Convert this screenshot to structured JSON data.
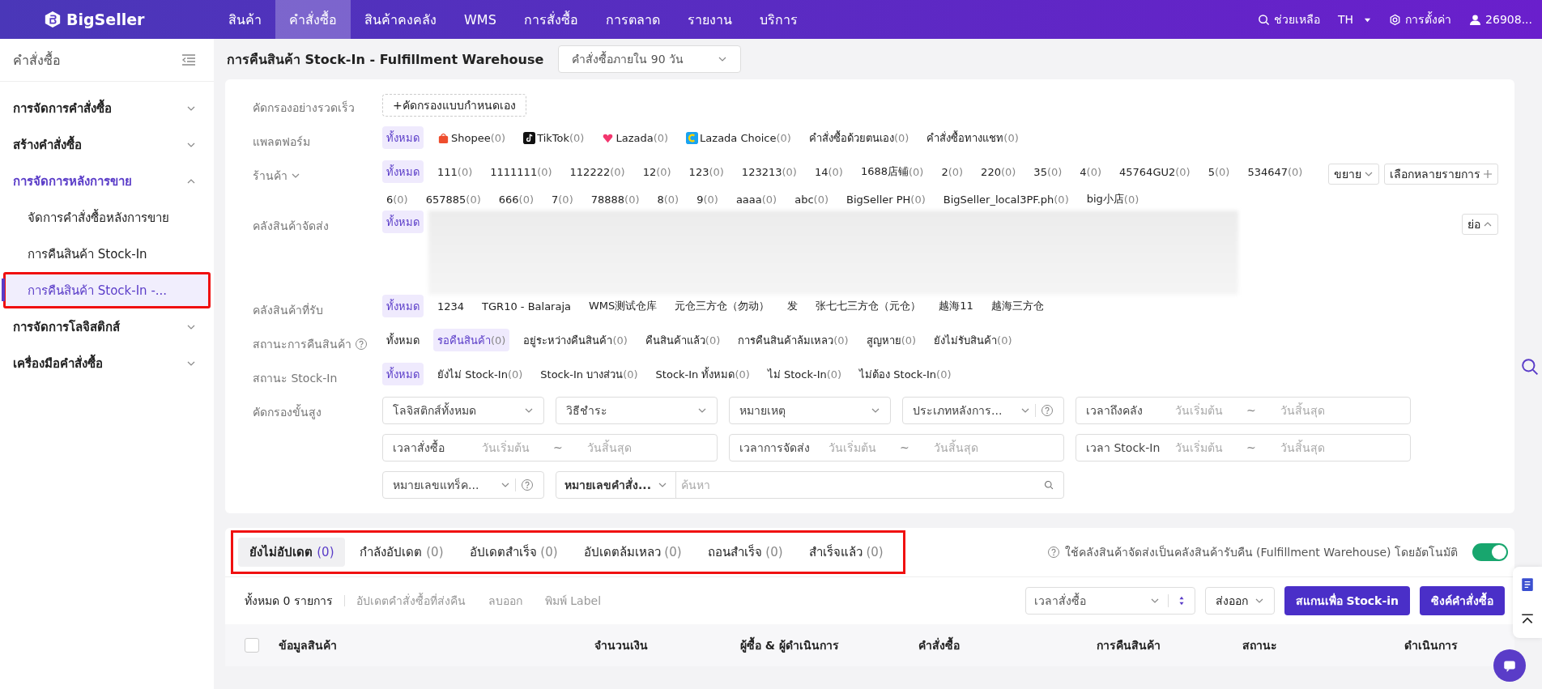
{
  "top_nav": {
    "logo": "BigSeller",
    "items": [
      {
        "label": "สินค้า",
        "selected": false
      },
      {
        "label": "คำสั่งซื้อ",
        "selected": true
      },
      {
        "label": "สินค้าคงคลัง",
        "selected": false
      },
      {
        "label": "WMS",
        "selected": false
      },
      {
        "label": "การสั่งซื้อ",
        "selected": false
      },
      {
        "label": "การตลาด",
        "selected": false
      },
      {
        "label": "รายงาน",
        "selected": false
      },
      {
        "label": "บริการ",
        "selected": false
      }
    ],
    "help": "ช่วยเหลือ",
    "language": "TH",
    "settings": "การตั้งค่า",
    "user": "26908..."
  },
  "sidebar": {
    "title": "คำสั่งซื้อ",
    "groups": [
      {
        "label": "การจัดการคำสั่งซื้อ",
        "expanded": false
      },
      {
        "label": "สร้างคำสั่งซื้อ",
        "expanded": false
      },
      {
        "label": "การจัดการหลังการขาย",
        "expanded": true,
        "children": [
          {
            "label": "จัดการคำสั่งซื้อหลังการขาย",
            "selected": false,
            "highlighted": false
          },
          {
            "label": "การคืนสินค้า Stock-In",
            "selected": false,
            "highlighted": false
          },
          {
            "label": "การคืนสินค้า Stock-In -...",
            "selected": true,
            "highlighted": true
          }
        ]
      },
      {
        "label": "การจัดการโลจิสติกส์",
        "expanded": false
      },
      {
        "label": "เครื่องมือคำสั่งซื้อ",
        "expanded": false
      }
    ]
  },
  "page": {
    "title": "การคืนสินค้า Stock-In - Fulfillment Warehouse",
    "period": "คำสั่งซื้อภายใน 90 วัน"
  },
  "filters": {
    "quick": {
      "label": "คัดกรองอย่างรวดเร็ว",
      "button": "+คัดกรองแบบกำหนดเอง"
    },
    "platform": {
      "label": "แพลตฟอร์ม",
      "options": [
        {
          "label": "ทั้งหมด",
          "selected": true,
          "kind": "all"
        },
        {
          "label": "Shopee",
          "count": "(0)",
          "selected": false,
          "kind": "shopee"
        },
        {
          "label": "TikTok",
          "count": "(0)",
          "selected": false,
          "kind": "tiktok"
        },
        {
          "label": "Lazada",
          "count": "(0)",
          "selected": false,
          "kind": "lazada"
        },
        {
          "label": "Lazada Choice",
          "count": "(0)",
          "selected": false,
          "kind": "lazada_choice"
        },
        {
          "label": "คำสั่งซื้อด้วยตนเอง",
          "count": "(0)",
          "selected": false,
          "kind": "plain"
        },
        {
          "label": "คำสั่งซื้อทางแชท",
          "count": "(0)",
          "selected": false,
          "kind": "plain"
        }
      ]
    },
    "shop": {
      "label": "ร้านค้า",
      "expand": "ขยาย",
      "multi": "เลือกหลายรายการ",
      "options": [
        {
          "label": "ทั้งหมด",
          "selected": true
        },
        {
          "label": "111",
          "count": "(0)",
          "selected": false
        },
        {
          "label": "1111111",
          "count": "(0)",
          "selected": false
        },
        {
          "label": "112222",
          "count": "(0)",
          "selected": false
        },
        {
          "label": "12",
          "count": "(0)",
          "selected": false
        },
        {
          "label": "123",
          "count": "(0)",
          "selected": false
        },
        {
          "label": "123213",
          "count": "(0)",
          "selected": false
        },
        {
          "label": "14",
          "count": "(0)",
          "selected": false
        },
        {
          "label": "1688店铺",
          "count": "(0)",
          "selected": false
        },
        {
          "label": "2",
          "count": "(0)",
          "selected": false
        },
        {
          "label": "220",
          "count": "(0)",
          "selected": false
        },
        {
          "label": "35",
          "count": "(0)",
          "selected": false
        },
        {
          "label": "4",
          "count": "(0)",
          "selected": false
        },
        {
          "label": "45764GU2",
          "count": "(0)",
          "selected": false
        },
        {
          "label": "5",
          "count": "(0)",
          "selected": false
        },
        {
          "label": "534647",
          "count": "(0)",
          "selected": false
        },
        {
          "label": "6",
          "count": "(0)",
          "selected": false
        },
        {
          "label": "657885",
          "count": "(0)",
          "selected": false
        },
        {
          "label": "666",
          "count": "(0)",
          "selected": false
        },
        {
          "label": "7",
          "count": "(0)",
          "selected": false
        },
        {
          "label": "78888",
          "count": "(0)",
          "selected": false
        },
        {
          "label": "8",
          "count": "(0)",
          "selected": false
        },
        {
          "label": "9",
          "count": "(0)",
          "selected": false
        },
        {
          "label": "aaaa",
          "count": "(0)",
          "selected": false
        },
        {
          "label": "abc",
          "count": "(0)",
          "selected": false
        },
        {
          "label": "BigSeller PH",
          "count": "(0)",
          "selected": false
        },
        {
          "label": "BigSeller_local3PF.ph",
          "count": "(0)",
          "selected": false
        },
        {
          "label": "big小店",
          "count": "(0)",
          "selected": false
        }
      ]
    },
    "shipping_warehouse": {
      "label": "คลังสินค้าจัดส่ง",
      "collapse": "ย่อ",
      "options": [
        {
          "label": "ทั้งหมด",
          "selected": true
        }
      ]
    },
    "receiving_warehouse": {
      "label": "คลังสินค้าที่รับ",
      "options": [
        {
          "label": "ทั้งหมด",
          "selected": true
        },
        {
          "label": "1234",
          "selected": false
        },
        {
          "label": "TGR10 - Balaraja",
          "selected": false
        },
        {
          "label": "WMS测试仓库",
          "selected": false
        },
        {
          "label": "元仓三方仓（勿动）",
          "selected": false
        },
        {
          "label": "发",
          "selected": false
        },
        {
          "label": "张七七三方仓（元仓）",
          "selected": false
        },
        {
          "label": "越海11",
          "selected": false
        },
        {
          "label": "越海三方仓",
          "selected": false
        }
      ]
    },
    "return_status": {
      "label": "สถานะการคืนสินค้า",
      "options": [
        {
          "label": "ทั้งหมด",
          "selected": false
        },
        {
          "label": "รอคืนสินค้า",
          "count": "(0)",
          "selected": true
        },
        {
          "label": "อยู่ระหว่างคืนสินค้า",
          "count": "(0)",
          "selected": false
        },
        {
          "label": "คืนสินค้าแล้ว",
          "count": "(0)",
          "selected": false
        },
        {
          "label": "การคืนสินค้าล้มเหลว",
          "count": "(0)",
          "selected": false
        },
        {
          "label": "สูญหาย",
          "count": "(0)",
          "selected": false
        },
        {
          "label": "ยังไม่รับสินค้า",
          "count": "(0)",
          "selected": false
        }
      ]
    },
    "stockin_status": {
      "label": "สถานะ Stock-In",
      "options": [
        {
          "label": "ทั้งหมด",
          "selected": true
        },
        {
          "label": "ยังไม่ Stock-In",
          "count": "(0)",
          "selected": false
        },
        {
          "label": "Stock-In บางส่วน",
          "count": "(0)",
          "selected": false
        },
        {
          "label": "Stock-In ทั้งหมด",
          "count": "(0)",
          "selected": false
        },
        {
          "label": "ไม่ Stock-In",
          "count": "(0)",
          "selected": false
        },
        {
          "label": "ไม่ต้อง Stock-In",
          "count": "(0)",
          "selected": false
        }
      ]
    },
    "advanced": {
      "label": "คัดกรองขั้นสูง",
      "fields": [
        {
          "kind": "select",
          "value": "โลจิสติกส์ทั้งหมด"
        },
        {
          "kind": "select",
          "value": "วิธีชำระ"
        },
        {
          "kind": "select",
          "value": "หมายเหตุ"
        },
        {
          "kind": "select_help",
          "value": "ประเภทหลังการ..."
        },
        {
          "kind": "date_range",
          "label": "เวลาถึงคลัง",
          "start": "วันเริ่มต้น",
          "separator": "~",
          "end": "วันสิ้นสุด"
        },
        {
          "kind": "date_range",
          "label": "เวลาสั่งซื้อ",
          "start": "วันเริ่มต้น",
          "separator": "~",
          "end": "วันสิ้นสุด"
        },
        {
          "kind": "date_range",
          "label": "เวลาการจัดส่ง",
          "start": "วันเริ่มต้น",
          "separator": "~",
          "end": "วันสิ้นสุด"
        },
        {
          "kind": "date_range",
          "label": "เวลา Stock-In",
          "start": "วันเริ่มต้น",
          "separator": "~",
          "end": "วันสิ้นสุด"
        },
        {
          "kind": "select_help",
          "value": "หมายเลขแทร็ค..."
        },
        {
          "kind": "combo_search",
          "value": "หมายเลขคำสั่ง...",
          "placeholder": "ค้นหา"
        }
      ]
    }
  },
  "update_tabs": {
    "highlighted": true,
    "items": [
      {
        "label": "ยังไม่อัปเดต",
        "count": "(0)",
        "selected": true
      },
      {
        "label": "กำลังอัปเดต",
        "count": "(0)",
        "selected": false
      },
      {
        "label": "อัปเดตสำเร็จ",
        "count": "(0)",
        "selected": false
      },
      {
        "label": "อัปเดตล้มเหลว",
        "count": "(0)",
        "selected": false
      },
      {
        "label": "ถอนสำเร็จ",
        "count": "(0)",
        "selected": false
      },
      {
        "label": "สำเร็จแล้ว",
        "count": "(0)",
        "selected": false
      }
    ],
    "auto_option": {
      "label": "ใช้คลังสินค้าจัดส่งเป็นคลังสินค้ารับคืน (Fulfillment Warehouse) โดยอัตโนมัติ",
      "on": true
    }
  },
  "toolbar": {
    "total": "ทั้งหมด 0 รายการ",
    "actions": [
      {
        "label": "อัปเดตคำสั่งซื้อที่ส่งคืน",
        "disabled": true
      },
      {
        "label": "ลบออก",
        "disabled": true
      },
      {
        "label": "พิมพ์ Label",
        "disabled": true
      }
    ],
    "sort": "เวลาสั่งซื้อ",
    "export": "ส่งออก",
    "scan": "สแกนเพื่อ Stock-in",
    "sync": "ซิงค์คำสั่งซื้อ"
  },
  "table": {
    "select_all": {
      "checked": false
    },
    "columns": [
      "ข้อมูลสินค้า",
      "จำนวนเงิน",
      "ผู้ซื้อ & ผู้ดำเนินการ",
      "คำสั่งซื้อ",
      "การคืนสินค้า",
      "สถานะ",
      "ดำเนินการ"
    ]
  }
}
